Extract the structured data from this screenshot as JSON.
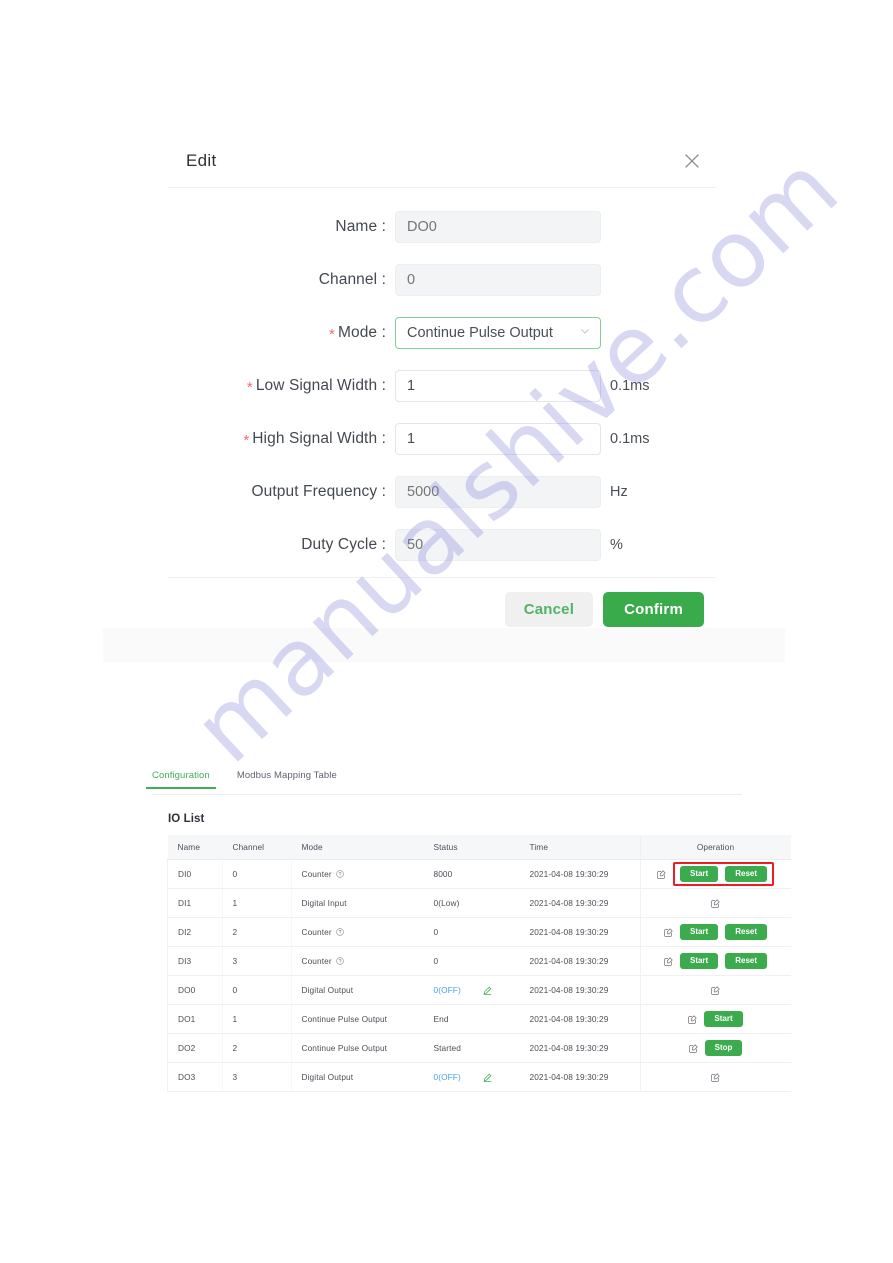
{
  "watermark": {
    "text": "manualshive.com"
  },
  "dialog": {
    "title": "Edit",
    "close_icon": "close-icon",
    "fields": [
      {
        "label": "Name",
        "value": "DO0",
        "disabled": true,
        "required": false,
        "unit": ""
      },
      {
        "label": "Channel",
        "value": "0",
        "disabled": true,
        "required": false,
        "unit": ""
      },
      {
        "label": "Mode",
        "value": "Continue Pulse Output",
        "disabled": false,
        "required": true,
        "unit": "",
        "type": "select"
      },
      {
        "label": "Low Signal Width",
        "value": "1",
        "disabled": false,
        "required": true,
        "unit": "0.1ms"
      },
      {
        "label": "High Signal Width",
        "value": "1",
        "disabled": false,
        "required": true,
        "unit": "0.1ms"
      },
      {
        "label": "Output Frequency",
        "value": "5000",
        "disabled": true,
        "required": false,
        "unit": "Hz"
      },
      {
        "label": "Duty Cycle",
        "value": "50",
        "disabled": true,
        "required": false,
        "unit": "%"
      }
    ],
    "cancel_label": "Cancel",
    "confirm_label": "Confirm",
    "colors": {
      "confirm_bg": "#39ab4b",
      "cancel_text": "#51b364",
      "required_star": "#f56c6c",
      "select_border": "#7ed494"
    }
  },
  "tabs": [
    {
      "label": "Configuration",
      "active": true
    },
    {
      "label": "Modbus Mapping Table",
      "active": false
    }
  ],
  "io_list": {
    "title": "IO List",
    "columns": [
      "Name",
      "Channel",
      "Mode",
      "Status",
      "Time",
      "Operation"
    ],
    "rows": [
      {
        "name": "DI0",
        "channel": "0",
        "mode": "Counter",
        "mode_help": true,
        "status": "8000",
        "status_link": false,
        "status_edit": false,
        "time": "2021-04-08 19:30:29",
        "edit": true,
        "buttons": [
          "Start",
          "Reset"
        ],
        "highlight": true
      },
      {
        "name": "DI1",
        "channel": "1",
        "mode": "Digital Input",
        "mode_help": false,
        "status": "0(Low)",
        "status_link": false,
        "status_edit": false,
        "time": "2021-04-08 19:30:29",
        "edit": true,
        "buttons": [],
        "highlight": false
      },
      {
        "name": "DI2",
        "channel": "2",
        "mode": "Counter",
        "mode_help": true,
        "status": "0",
        "status_link": false,
        "status_edit": false,
        "time": "2021-04-08 19:30:29",
        "edit": true,
        "buttons": [
          "Start",
          "Reset"
        ],
        "highlight": false
      },
      {
        "name": "DI3",
        "channel": "3",
        "mode": "Counter",
        "mode_help": true,
        "status": "0",
        "status_link": false,
        "status_edit": false,
        "time": "2021-04-08 19:30:29",
        "edit": true,
        "buttons": [
          "Start",
          "Reset"
        ],
        "highlight": false
      },
      {
        "name": "DO0",
        "channel": "0",
        "mode": "Digital Output",
        "mode_help": false,
        "status": "0(OFF)",
        "status_link": true,
        "status_edit": true,
        "time": "2021-04-08 19:30:29",
        "edit": true,
        "buttons": [],
        "highlight": false
      },
      {
        "name": "DO1",
        "channel": "1",
        "mode": "Continue Pulse Output",
        "mode_help": false,
        "status": "End",
        "status_link": false,
        "status_edit": false,
        "time": "2021-04-08 19:30:29",
        "edit": true,
        "buttons": [
          "Start"
        ],
        "highlight": false
      },
      {
        "name": "DO2",
        "channel": "2",
        "mode": "Continue Pulse Output",
        "mode_help": false,
        "status": "Started",
        "status_link": false,
        "status_edit": false,
        "time": "2021-04-08 19:30:29",
        "edit": true,
        "buttons": [
          "Stop"
        ],
        "highlight": false
      },
      {
        "name": "DO3",
        "channel": "3",
        "mode": "Digital Output",
        "mode_help": false,
        "status": "0(OFF)",
        "status_link": true,
        "status_edit": true,
        "time": "2021-04-08 19:30:29",
        "edit": true,
        "buttons": [],
        "highlight": false
      }
    ]
  }
}
